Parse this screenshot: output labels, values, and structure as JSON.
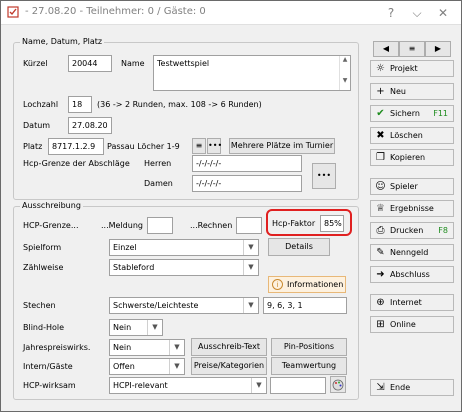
{
  "window": {
    "title": "- 27.08.20 - Teilnehmer: 0 / Gäste: 0"
  },
  "titlebar": {
    "help": "?",
    "minimize": "⌵",
    "close": "✕"
  },
  "group1": {
    "title": "Name, Datum, Platz",
    "kuerzel_label": "Kürzel",
    "kuerzel_value": "20044",
    "name_label": "Name",
    "name_value": "Testwettspiel",
    "lochzahl_label": "Lochzahl",
    "lochzahl_value": "18",
    "lochzahl_note": "(36 -> 2 Runden, max. 108 -> 6 Runden)",
    "datum_label": "Datum",
    "datum_value": "27.08.20",
    "platz_label": "Platz",
    "platz_value": "8717.1.2.9",
    "platz_name": "Passau Löcher 1-9",
    "mehrere_button": "Mehrere Plätze im Turnier",
    "hcp_grenze_label": "Hcp-Grenze der Abschläge",
    "herren_label": "Herren",
    "herren_value": "-/-/-/-/-",
    "damen_label": "Damen",
    "damen_value": "-/-/-/-/-",
    "more_button": "•••"
  },
  "group2": {
    "title": "Ausschreibung",
    "hcp_grenze_label": "HCP-Grenze...",
    "meldung_label": "...Meldung",
    "rechnen_label": "...Rechnen",
    "hcp_faktor_label": "Hcp-Faktor",
    "hcp_faktor_value": "85%",
    "spielform_label": "Spielform",
    "spielform_value": "Einzel",
    "details_button": "Details",
    "zaehlweise_label": "Zählweise",
    "zaehlweise_value": "Stableford",
    "informationen_button": "Informationen",
    "stechen_label": "Stechen",
    "stechen_value": "Schwerste/Leichteste",
    "stechen_holes": "9, 6, 3, 1",
    "blind_hole_label": "Blind-Hole",
    "blind_hole_value": "Nein",
    "jahrespreis_label": "Jahrespreiswirks.",
    "jahrespreis_value": "Nein",
    "ausschreib_button": "Ausschreib-Text",
    "pin_button": "Pin-Positions",
    "intern_label": "Intern/Gäste",
    "intern_value": "Offen",
    "preise_button": "Preise/Kategorien",
    "teamwertung_button": "Teamwertung",
    "hcp_wirksam_label": "HCP-wirksam",
    "hcp_wirksam_value": "HCPI-relevant"
  },
  "sidebar": {
    "prev": "◀",
    "menu": "≡",
    "next": "▶",
    "items": [
      {
        "label": "Projekt",
        "icon": "☼"
      },
      {
        "label": "Neu",
        "icon": "+"
      },
      {
        "label": "Sichern",
        "icon": "✔",
        "shortcut": "F11"
      },
      {
        "label": "Löschen",
        "icon": "✖"
      },
      {
        "label": "Kopieren",
        "icon": "❐"
      },
      {
        "label": "Spieler",
        "icon": "☺"
      },
      {
        "label": "Ergebnisse",
        "icon": "♕"
      },
      {
        "label": "Drucken",
        "icon": "⎙",
        "shortcut": "F8"
      },
      {
        "label": "Nenngeld",
        "icon": "✎"
      },
      {
        "label": "Abschluss",
        "icon": "➜"
      },
      {
        "label": "Internet",
        "icon": "⊕"
      },
      {
        "label": "Online",
        "icon": "⊞"
      },
      {
        "label": "Ende",
        "icon": "⇲"
      }
    ]
  }
}
